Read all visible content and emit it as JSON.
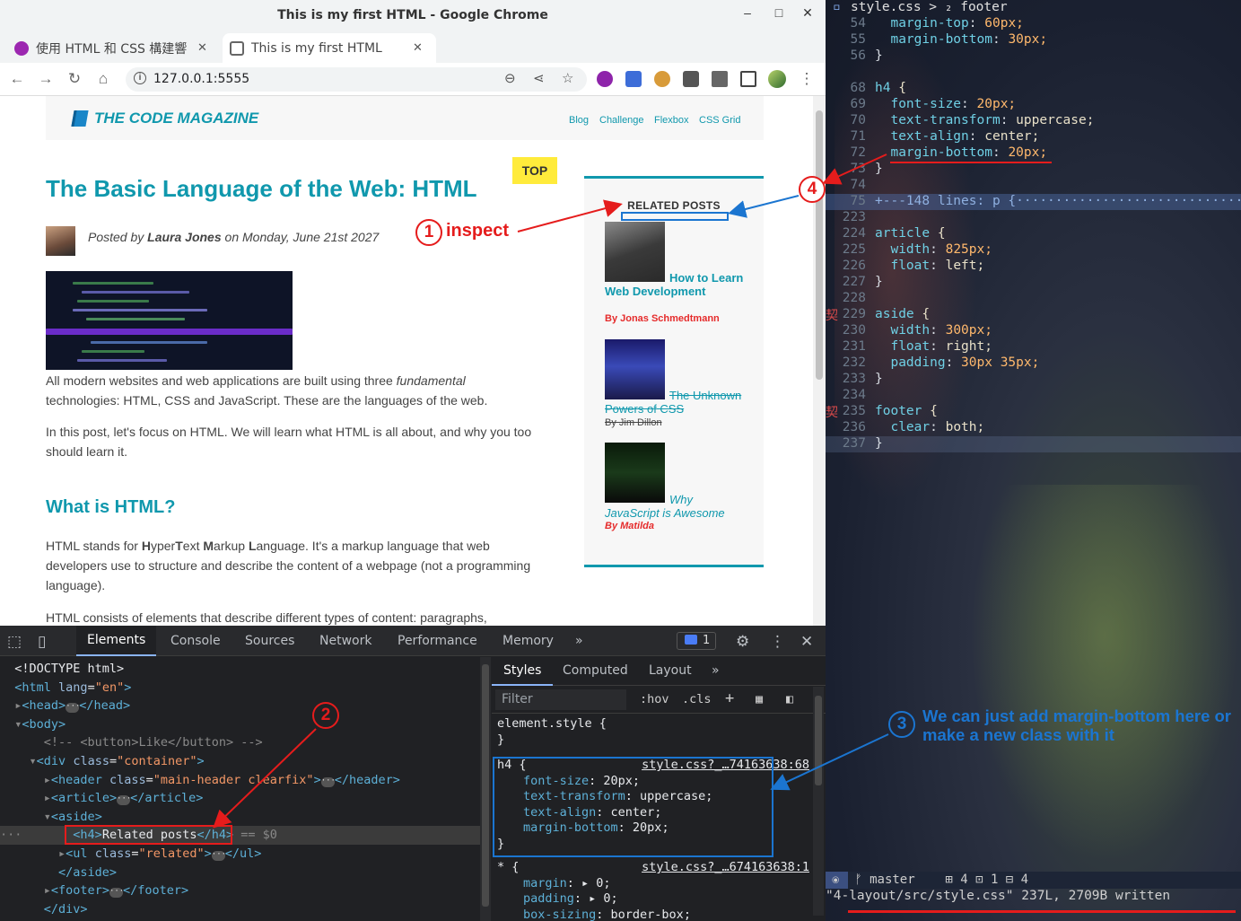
{
  "window": {
    "title": "This is my first HTML - Google Chrome",
    "minimize": "–",
    "maximize": "□",
    "close": "✕"
  },
  "tabs": [
    {
      "label": "使用 HTML 和 CSS 構建響",
      "close": "✕"
    },
    {
      "label": "This is my first HTML",
      "close": "✕"
    }
  ],
  "newtab": "+",
  "tabdrop": "⌄",
  "toolbar": {
    "back": "←",
    "forward": "→",
    "reload": "↻",
    "home": "⌂",
    "url": "127.0.0.1:5555",
    "zoom": "⊖",
    "share": "⋖",
    "star": "☆",
    "ext_menu": "⋮"
  },
  "site": {
    "logo": "THE CODE MAGAZINE",
    "nav": [
      "Blog",
      "Challenge",
      "Flexbox",
      "CSS Grid"
    ],
    "top_button": "TOP",
    "title": "The Basic Language of the Web: HTML",
    "posted_prefix": "Posted by",
    "author": "Laura Jones",
    "posted_suffix": "on Monday, June 21st 2027",
    "p1_a": "All modern websites and web applications are built using three",
    "p1_em": "fundamental",
    "p1_b": "technologies: HTML, CSS and JavaScript. These are the languages of the web.",
    "p2": "In this post, let's focus on HTML. We will learn what HTML is all about, and why you too should learn it.",
    "h2": "What is HTML?",
    "p3_parts": [
      "HTML stands for ",
      "H",
      "yper",
      "T",
      "ext ",
      "M",
      "arkup ",
      "L",
      "anguage. It's a markup language that web developers use to structure and describe the content of a webpage (not a programming language)."
    ],
    "p4": "HTML consists of elements that describe different types of content: paragraphs,",
    "related_heading": "RELATED POSTS",
    "related": [
      {
        "title": "How to Learn Web Development",
        "author": "By Jonas Schmedtmann"
      },
      {
        "title": "The Unknown Powers of CSS",
        "author": "By Jim Dillon"
      },
      {
        "title": "Why JavaScript is Awesome",
        "author": "By Matilda"
      }
    ]
  },
  "devtools": {
    "tabs": [
      "Elements",
      "Console",
      "Sources",
      "Network",
      "Performance",
      "Memory"
    ],
    "more": "»",
    "issues": "1",
    "dom": {
      "doctype": "<!DOCTYPE html>",
      "html_open": "<html",
      "html_attr": "lang",
      "html_val": "\"en\"",
      "head": "<head>",
      "head_close": "</head>",
      "body": "<body>",
      "comment": "<!-- <button>Like</button> -->",
      "div_open": "<div",
      "class_attr": "class",
      "div_val": "\"container\"",
      "header_open": "<header",
      "header_val": "\"main-header clearfix\"",
      "header_close": "</header>",
      "article": "<article>",
      "article_close": "</article>",
      "aside": "<aside>",
      "h4_open": "<h4>",
      "h4_text": "Related posts",
      "h4_close": "</h4>",
      "h4_eq": "== $0",
      "ul_open": "<ul",
      "ul_val": "\"related\"",
      "ul_close": "</ul>",
      "aside_close": "</aside>",
      "footer": "<footer>",
      "footer_close": "</footer>",
      "div_close": "</div>"
    },
    "styles_tabs": [
      "Styles",
      "Computed",
      "Layout"
    ],
    "filter_placeholder": "Filter",
    "hov": ":hov",
    "cls": ".cls",
    "element_style": "element.style {",
    "close_brace": "}",
    "rule1": {
      "selector": "h4 {",
      "source": "style.css?_…74163638:68",
      "decls": [
        {
          "p": "font-size",
          "v": ": 20px;"
        },
        {
          "p": "text-transform",
          "v": ": uppercase;"
        },
        {
          "p": "text-align",
          "v": ": center;"
        },
        {
          "p": "margin-bottom",
          "v": ": 20px;"
        }
      ]
    },
    "rule2": {
      "selector": "* {",
      "source": "style.css?_…674163638:1",
      "decls": [
        {
          "p": "margin",
          "v": ": ▸ 0;"
        },
        {
          "p": "padding",
          "v": ": ▸ 0;"
        },
        {
          "p": "box-sizing",
          "v": ": border-box;"
        }
      ]
    }
  },
  "editor": {
    "breadcrumb": "style.css > ₂ footer",
    "lines": [
      {
        "n": "54",
        "t": "  margin-top: 60px;"
      },
      {
        "n": "55",
        "t": "  margin-bottom: 30px;"
      },
      {
        "n": "56",
        "t": "}"
      },
      {
        "n": "",
        "t": ""
      },
      {
        "n": "68",
        "t": "h4 {"
      },
      {
        "n": "69",
        "t": "  font-size: 20px;"
      },
      {
        "n": "70",
        "t": "  text-transform: uppercase;"
      },
      {
        "n": "71",
        "t": "  text-align: center;"
      },
      {
        "n": "72",
        "t": "  margin-bottom: 20px;"
      },
      {
        "n": "73",
        "t": "}"
      },
      {
        "n": "74",
        "t": ""
      },
      {
        "n": "75",
        "t": "+---148 lines: p {·······························"
      },
      {
        "n": "223",
        "t": ""
      },
      {
        "n": "224",
        "t": "article {"
      },
      {
        "n": "225",
        "t": "  width: 825px;"
      },
      {
        "n": "226",
        "t": "  float: left;"
      },
      {
        "n": "227",
        "t": "}"
      },
      {
        "n": "228",
        "t": ""
      },
      {
        "n": "229",
        "t": "aside {"
      },
      {
        "n": "230",
        "t": "  width: 300px;"
      },
      {
        "n": "231",
        "t": "  float: right;"
      },
      {
        "n": "232",
        "t": "  padding: 30px 35px;"
      },
      {
        "n": "233",
        "t": "}"
      },
      {
        "n": "234",
        "t": ""
      },
      {
        "n": "235",
        "t": "footer {"
      },
      {
        "n": "236",
        "t": "  clear: both;"
      },
      {
        "n": "237",
        "t": "}"
      }
    ],
    "cjk_marks": [
      "契",
      "契"
    ],
    "status": "⦿  ᚠ master    ⊞ 4 ⊡ 1 ⊟ 4",
    "cmdline": "\"4-layout/src/style.css\" 237L, 2709B written"
  },
  "annotations": {
    "n1": "1",
    "inspect": "inspect",
    "n2": "2",
    "n3": "3",
    "note3": "We can just add margin-bottom here or make a new class with it",
    "n4": "4",
    "red": "#e51c1c",
    "blue": "#1b75d0"
  }
}
